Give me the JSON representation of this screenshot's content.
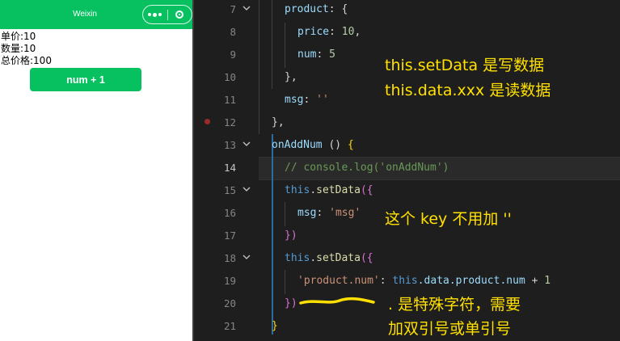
{
  "simulator": {
    "nav_title": "Weixin",
    "lines": [
      {
        "label": "单价:",
        "value": "10"
      },
      {
        "label": "数量:",
        "value": "10"
      },
      {
        "label": "总价格:",
        "value": "100"
      }
    ],
    "button_label": "num + 1",
    "accent": "#07c160"
  },
  "editor": {
    "active_line": "14",
    "line_numbers": [
      "7",
      "8",
      "9",
      "10",
      "11",
      "12",
      "13",
      "14",
      "15",
      "16",
      "17",
      "18",
      "19",
      "20",
      "21"
    ],
    "code": {
      "l7_key": "product",
      "l7_punct": ": {",
      "l8_key": "price",
      "l8_colon": ": ",
      "l8_val": "10",
      "l8_comma": ",",
      "l9_key": "num",
      "l9_colon": ": ",
      "l9_val": "5",
      "l10": "},",
      "l11_key": "msg",
      "l11_colon": ": ",
      "l11_val": "''",
      "l12": "},",
      "l13_fn": "onAddNum",
      "l13_paren": " () ",
      "l13_brace": "{",
      "l14_comment": "// console.log('onAddNum')",
      "l15_this": "this",
      "l15_dot": ".",
      "l15_fn": "setData",
      "l15_open": "(",
      "l15_brace": "{",
      "l16_key": "msg",
      "l16_colon": ": ",
      "l16_val": "'msg'",
      "l17_brace": "}",
      "l17_close": ")",
      "l18_this": "this",
      "l18_dot": ".",
      "l18_fn": "setData",
      "l18_open": "(",
      "l18_brace": "{",
      "l19_key": "'product.num'",
      "l19_colon": ": ",
      "l19_this": "this",
      "l19_rest": ".data.product.num",
      "l19_op": " + ",
      "l19_val": "1",
      "l20_brace": "}",
      "l20_close": ")",
      "l21": "}"
    },
    "annotations": {
      "note1_line1": "this.setData 是写数据",
      "note1_line2": "this.data.xxx 是读数据",
      "note2": "这个 key 不用加 ''",
      "note3_line1": ". 是特殊字符，需要",
      "note3_line2": "加双引号或单引号"
    },
    "note_color": "#ffe000"
  }
}
